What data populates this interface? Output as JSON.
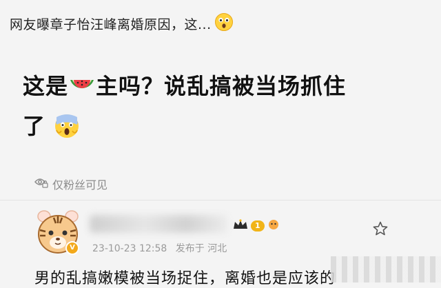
{
  "headline": {
    "text": "网友曝章子怡汪峰离婚原因，这...",
    "emoji_icon": "astonished-face-icon"
  },
  "post": {
    "line1_before": "这是",
    "line1_emoji_icon": "watermelon-icon",
    "line1_after": "主吗？说乱搞被当场抓住",
    "line2": "了",
    "line2_emoji_icon": "screaming-face-icon"
  },
  "visibility": {
    "icon": "eye-lock-icon",
    "label": "仅粉丝可见"
  },
  "comment": {
    "avatar_icon": "tiger-avatar-icon",
    "verified_icon": "verified-badge-icon",
    "level_badge": "1",
    "timestamp": "23-10-23 12:58",
    "location": "发布于 河北",
    "favorite_icon": "star-outline-icon",
    "text": "男的乱搞嫩模被当场捉住，离婚也是应该的"
  },
  "colors": {
    "accent_gold": "#f1b418",
    "meta_gray": "#9a9a9a",
    "background": "#f4f4f4"
  }
}
